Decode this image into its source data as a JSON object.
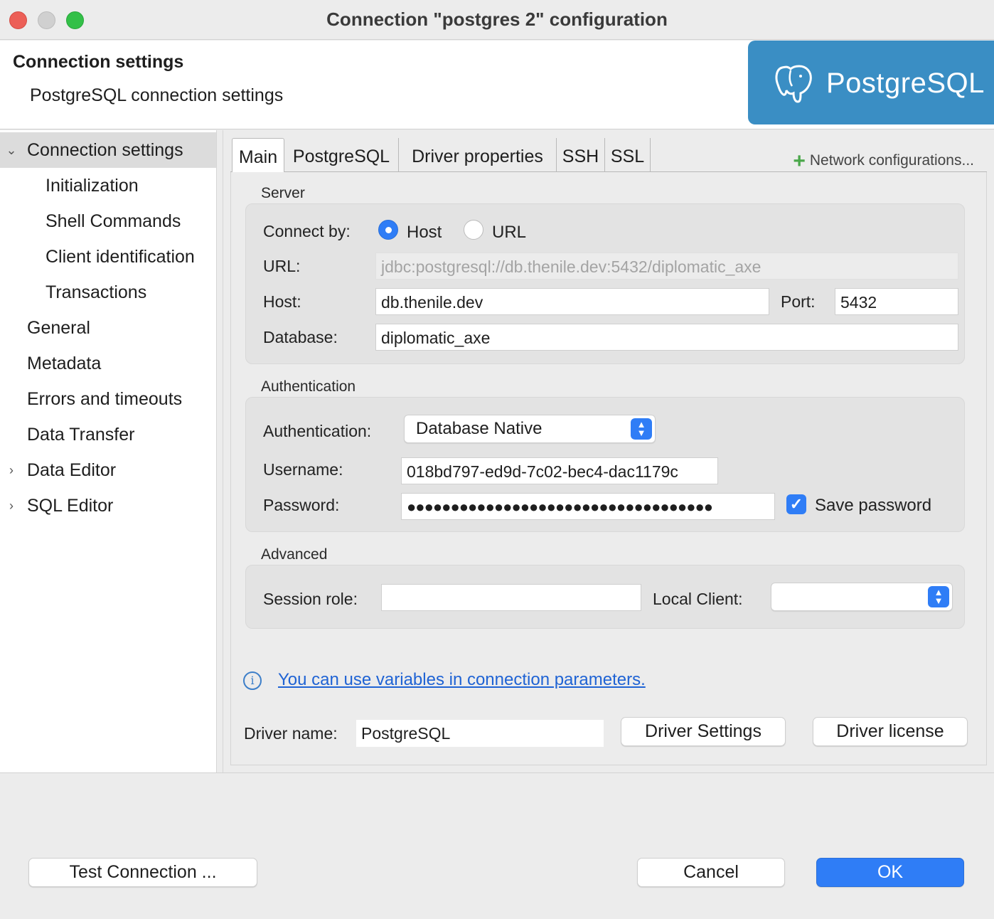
{
  "window": {
    "title": "Connection \"postgres 2\" configuration"
  },
  "header": {
    "title": "Connection settings",
    "subtitle": "PostgreSQL connection settings",
    "logo_text": "PostgreSQL",
    "logo_color": "#3a8ec4"
  },
  "sidebar": {
    "items": [
      {
        "label": "Connection settings",
        "chevron": "expanded",
        "selected": true
      },
      {
        "label": "Initialization"
      },
      {
        "label": "Shell Commands"
      },
      {
        "label": "Client identification"
      },
      {
        "label": "Transactions"
      },
      {
        "label": "General"
      },
      {
        "label": "Metadata"
      },
      {
        "label": "Errors and timeouts"
      },
      {
        "label": "Data Transfer"
      },
      {
        "label": "Data Editor",
        "chevron": "collapsed"
      },
      {
        "label": "SQL Editor",
        "chevron": "collapsed"
      }
    ]
  },
  "tabs": {
    "items": [
      "Main",
      "PostgreSQL",
      "Driver properties",
      "SSH",
      "SSL"
    ],
    "active": "Main",
    "network_config_label": "Network configurations..."
  },
  "server": {
    "group_label": "Server",
    "connect_by_label": "Connect by:",
    "host_option": "Host",
    "url_option": "URL",
    "selected": "Host",
    "url_label": "URL:",
    "url_value": "jdbc:postgresql://db.thenile.dev:5432/diplomatic_axe",
    "host_label": "Host:",
    "host_value": "db.thenile.dev",
    "port_label": "Port:",
    "port_value": "5432",
    "database_label": "Database:",
    "database_value": "diplomatic_axe"
  },
  "auth": {
    "group_label": "Authentication",
    "auth_label": "Authentication:",
    "auth_value": "Database Native",
    "username_label": "Username:",
    "username_value": "018bd797-ed9d-7c02-bec4-dac1179c",
    "password_label": "Password:",
    "password_value": "●●●●●●●●●●●●●●●●●●●●●●●●●●●●●●●●●●●",
    "save_password_label": "Save password",
    "save_password_checked": true
  },
  "advanced": {
    "group_label": "Advanced",
    "session_role_label": "Session role:",
    "session_role_value": "",
    "local_client_label": "Local Client:",
    "local_client_value": ""
  },
  "info": {
    "link_text": "You can use variables in connection parameters."
  },
  "driver": {
    "name_label": "Driver name:",
    "name_value": "PostgreSQL",
    "settings_button": "Driver Settings",
    "license_button": "Driver license"
  },
  "footer": {
    "test_button": "Test Connection ...",
    "cancel_button": "Cancel",
    "ok_button": "OK"
  },
  "colors": {
    "accent": "#2f7df6",
    "link": "#1f63d4",
    "add_icon": "#4aa74a"
  },
  "icons": {
    "add": "plus-icon",
    "info": "info-icon",
    "chevron_expanded": "chevron-down-icon",
    "chevron_collapsed": "chevron-right-icon"
  }
}
